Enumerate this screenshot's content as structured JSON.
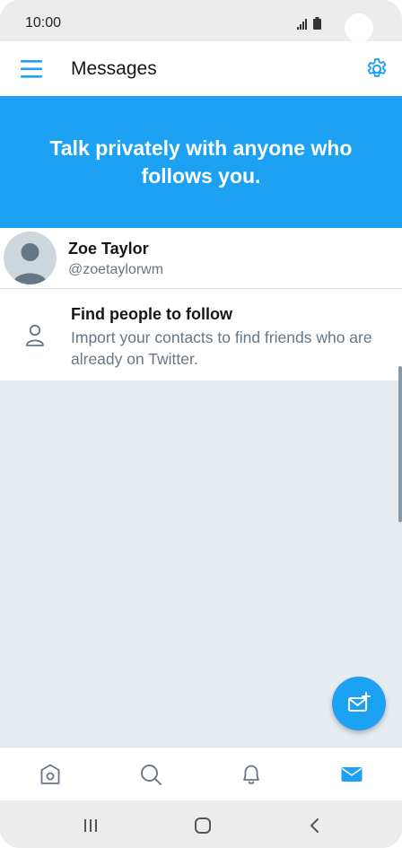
{
  "status_bar": {
    "time": "10:00"
  },
  "header": {
    "title": "Messages",
    "menu_icon": "hamburger-menu-icon",
    "settings_icon": "gear-icon"
  },
  "banner": {
    "text": "Talk privately with anyone who follows you."
  },
  "account": {
    "name": "Zoe Taylor",
    "handle": "@zoetaylorwm"
  },
  "find_people": {
    "title": "Find people to follow",
    "description": "Import your contacts to find friends who are already on Twitter.",
    "icon": "person-icon"
  },
  "fab": {
    "icon": "new-message-icon"
  },
  "bottom_nav": {
    "items": [
      {
        "icon": "home-icon",
        "active": false
      },
      {
        "icon": "search-icon",
        "active": false
      },
      {
        "icon": "bell-icon",
        "active": false
      },
      {
        "icon": "envelope-icon",
        "active": true
      }
    ]
  },
  "system_nav": {
    "items": [
      "recents-icon",
      "home-button-icon",
      "back-icon"
    ]
  },
  "colors": {
    "accent": "#1da1f2",
    "text_primary": "#14171a",
    "text_secondary": "#657786",
    "empty_bg": "#e6ecf0"
  }
}
